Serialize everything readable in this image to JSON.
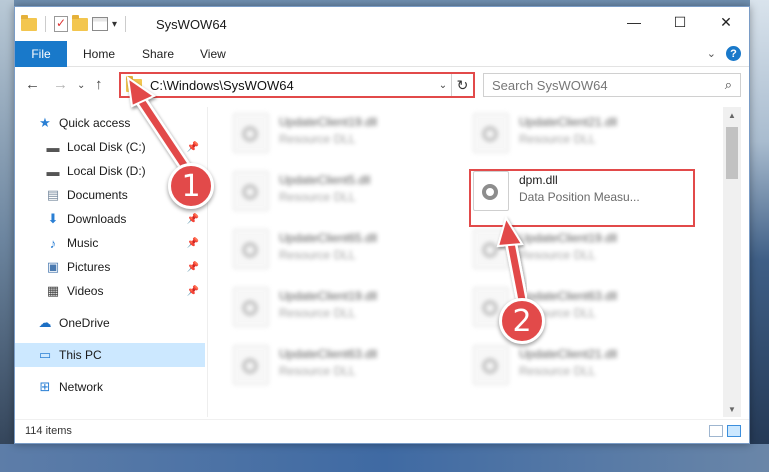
{
  "window": {
    "title": "SysWOW64",
    "minimize_glyph": "—",
    "maximize_glyph": "☐",
    "close_glyph": "✕"
  },
  "ribbon": {
    "file_label": "File",
    "tabs": [
      "Home",
      "Share",
      "View"
    ]
  },
  "navigation": {
    "address": "C:\\Windows\\SysWOW64",
    "search_placeholder": "Search SysWOW64"
  },
  "sidebar": {
    "items": [
      {
        "label": "Quick access",
        "icon": "star-icon"
      },
      {
        "label": "Local Disk (C:)",
        "icon": "drive-icon",
        "pinned": true
      },
      {
        "label": "Local Disk (D:)",
        "icon": "drive-icon"
      },
      {
        "label": "Documents",
        "icon": "documents-icon",
        "pinned": true
      },
      {
        "label": "Downloads",
        "icon": "download-icon",
        "pinned": true
      },
      {
        "label": "Music",
        "icon": "music-icon",
        "pinned": true
      },
      {
        "label": "Pictures",
        "icon": "pictures-icon",
        "pinned": true
      },
      {
        "label": "Videos",
        "icon": "video-icon",
        "pinned": true
      },
      {
        "label": "OneDrive",
        "icon": "cloud-icon"
      },
      {
        "label": "This PC",
        "icon": "computer-icon",
        "selected": true
      },
      {
        "label": "Network",
        "icon": "network-icon"
      }
    ]
  },
  "files": {
    "left_column": [
      {
        "name": "UpdateClient19.dll",
        "desc": "Resource DLL"
      },
      {
        "name": "UpdateClient5.dll",
        "desc": "Resource DLL"
      },
      {
        "name": "UpdateClient65.dll",
        "desc": "Resource DLL"
      },
      {
        "name": "UpdateClient19.dll",
        "desc": "Resource DLL"
      },
      {
        "name": "UpdateClient63.dll",
        "desc": "Resource DLL"
      }
    ],
    "right_column": [
      {
        "name": "UpdateClient21.dll",
        "desc": "Resource DLL"
      },
      {
        "name": "dpm.dll",
        "desc": "Data Position Measu...",
        "highlight": true
      },
      {
        "name": "UpdateClient19.dll",
        "desc": "Resource DLL"
      },
      {
        "name": "UpdateClient63.dll",
        "desc": "Resource DLL"
      },
      {
        "name": "UpdateClient21.dll",
        "desc": "Resource DLL"
      }
    ]
  },
  "status": {
    "count": "114 items"
  },
  "annotations": {
    "step1": "1",
    "step2": "2",
    "accent": "#e24a4a"
  }
}
